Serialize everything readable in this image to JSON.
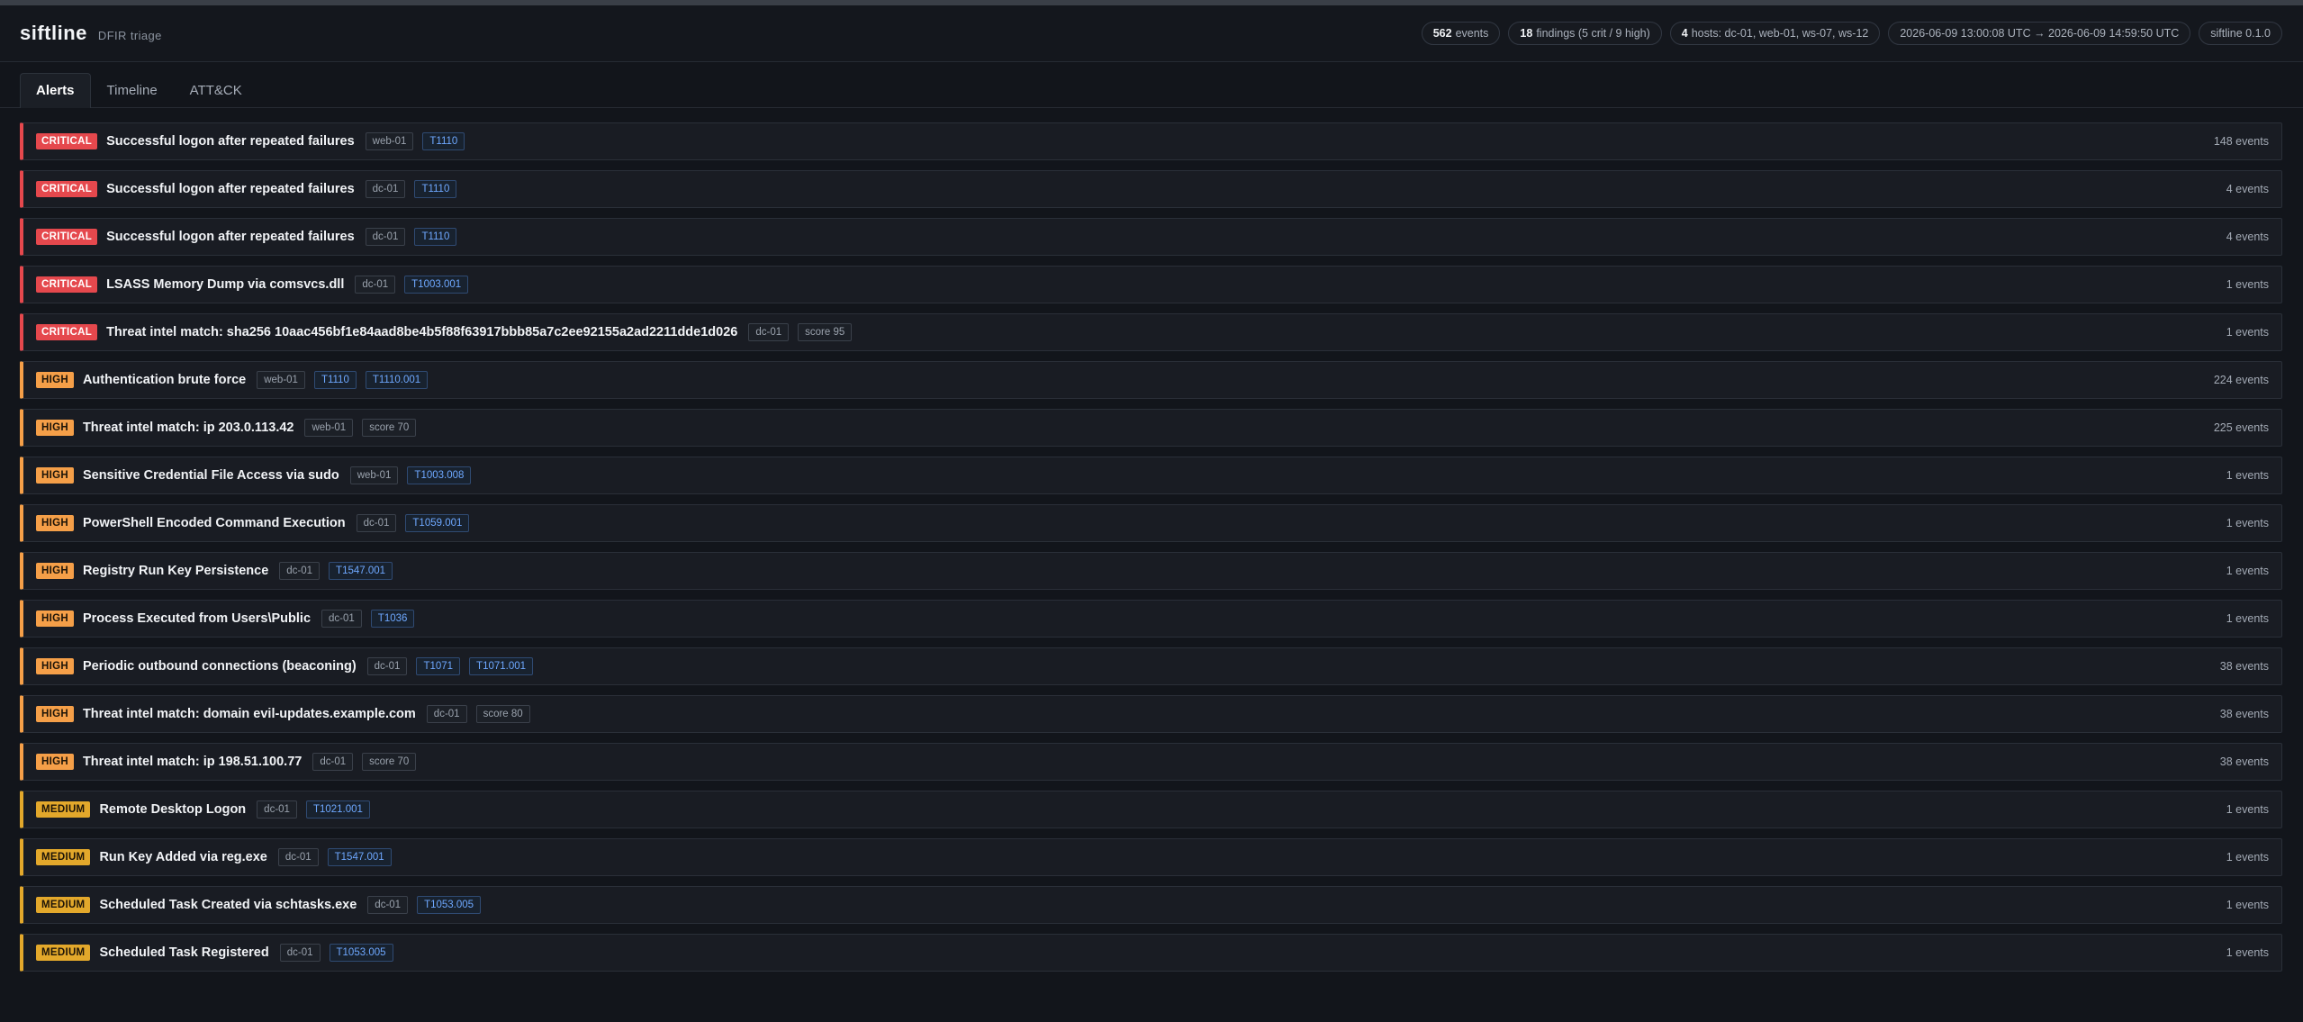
{
  "app": {
    "name": "siftline",
    "subtitle": "DFIR triage"
  },
  "stats": [
    {
      "value": "562",
      "label": "events"
    },
    {
      "value": "18",
      "label": "findings (5 crit / 9 high)"
    },
    {
      "value": "4",
      "label": "hosts: dc-01, web-01, ws-07, ws-12"
    },
    {
      "value": "",
      "label": "2026-06-09 13:00:08 UTC → 2026-06-09 14:59:50 UTC"
    },
    {
      "value": "",
      "label": "siftline 0.1.0"
    }
  ],
  "tabs": [
    {
      "label": "Alerts",
      "active": true
    },
    {
      "label": "Timeline",
      "active": false
    },
    {
      "label": "ATT&CK",
      "active": false
    }
  ],
  "alerts": [
    {
      "severity": "critical",
      "severity_label": "CRITICAL",
      "title": "Successful logon after repeated failures",
      "host": "web-01",
      "tags": [
        "T1110"
      ],
      "count": "148 events"
    },
    {
      "severity": "critical",
      "severity_label": "CRITICAL",
      "title": "Successful logon after repeated failures",
      "host": "dc-01",
      "tags": [
        "T1110"
      ],
      "count": "4 events"
    },
    {
      "severity": "critical",
      "severity_label": "CRITICAL",
      "title": "Successful logon after repeated failures",
      "host": "dc-01",
      "tags": [
        "T1110"
      ],
      "count": "4 events"
    },
    {
      "severity": "critical",
      "severity_label": "CRITICAL",
      "title": "LSASS Memory Dump via comsvcs.dll",
      "host": "dc-01",
      "tags": [
        "T1003.001"
      ],
      "count": "1 events"
    },
    {
      "severity": "critical",
      "severity_label": "CRITICAL",
      "title": "Threat intel match: sha256 10aac456bf1e84aad8be4b5f88f63917bbb85a7c2ee92155a2ad2211dde1d026",
      "host": "dc-01",
      "tags": [
        "score 95"
      ],
      "count": "1 events"
    },
    {
      "severity": "high",
      "severity_label": "HIGH",
      "title": "Authentication brute force",
      "host": "web-01",
      "tags": [
        "T1110",
        "T1110.001"
      ],
      "count": "224 events"
    },
    {
      "severity": "high",
      "severity_label": "HIGH",
      "title": "Threat intel match: ip 203.0.113.42",
      "host": "web-01",
      "tags": [
        "score 70"
      ],
      "count": "225 events"
    },
    {
      "severity": "high",
      "severity_label": "HIGH",
      "title": "Sensitive Credential File Access via sudo",
      "host": "web-01",
      "tags": [
        "T1003.008"
      ],
      "count": "1 events"
    },
    {
      "severity": "high",
      "severity_label": "HIGH",
      "title": "PowerShell Encoded Command Execution",
      "host": "dc-01",
      "tags": [
        "T1059.001"
      ],
      "count": "1 events"
    },
    {
      "severity": "high",
      "severity_label": "HIGH",
      "title": "Registry Run Key Persistence",
      "host": "dc-01",
      "tags": [
        "T1547.001"
      ],
      "count": "1 events"
    },
    {
      "severity": "high",
      "severity_label": "HIGH",
      "title": "Process Executed from Users\\Public",
      "host": "dc-01",
      "tags": [
        "T1036"
      ],
      "count": "1 events"
    },
    {
      "severity": "high",
      "severity_label": "HIGH",
      "title": "Periodic outbound connections (beaconing)",
      "host": "dc-01",
      "tags": [
        "T1071",
        "T1071.001"
      ],
      "count": "38 events"
    },
    {
      "severity": "high",
      "severity_label": "HIGH",
      "title": "Threat intel match: domain evil-updates.example.com",
      "host": "dc-01",
      "tags": [
        "score 80"
      ],
      "count": "38 events"
    },
    {
      "severity": "high",
      "severity_label": "HIGH",
      "title": "Threat intel match: ip 198.51.100.77",
      "host": "dc-01",
      "tags": [
        "score 70"
      ],
      "count": "38 events"
    },
    {
      "severity": "medium",
      "severity_label": "MEDIUM",
      "title": "Remote Desktop Logon",
      "host": "dc-01",
      "tags": [
        "T1021.001"
      ],
      "count": "1 events"
    },
    {
      "severity": "medium",
      "severity_label": "MEDIUM",
      "title": "Run Key Added via reg.exe",
      "host": "dc-01",
      "tags": [
        "T1547.001"
      ],
      "count": "1 events"
    },
    {
      "severity": "medium",
      "severity_label": "MEDIUM",
      "title": "Scheduled Task Created via schtasks.exe",
      "host": "dc-01",
      "tags": [
        "T1053.005"
      ],
      "count": "1 events"
    },
    {
      "severity": "medium",
      "severity_label": "MEDIUM",
      "title": "Scheduled Task Registered",
      "host": "dc-01",
      "tags": [
        "T1053.005"
      ],
      "count": "1 events"
    }
  ],
  "colors": {
    "critical": "#e5484d",
    "high": "#f59f48",
    "medium": "#e3a82b",
    "technique": "#6ea8ff",
    "background": "#12151b"
  }
}
